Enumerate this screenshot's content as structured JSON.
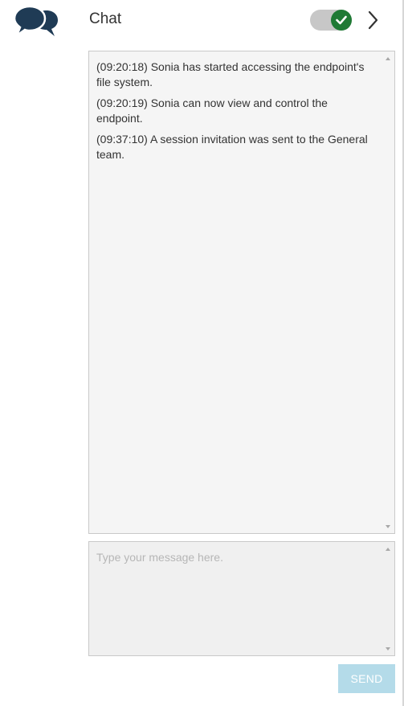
{
  "header": {
    "icon": "chat-bubbles-icon",
    "title": "Chat",
    "toggle": {
      "state": "on",
      "icon": "checkmark-icon",
      "knob_color": "#1f7a35"
    },
    "expand_icon": "chevron-right-icon"
  },
  "log": {
    "entries": [
      "(09:20:18) Sonia has started accessing the endpoint's file system.",
      "(09:20:19) Sonia can now view and control the endpoint.",
      "(09:37:10) A session invitation was sent to the General team."
    ]
  },
  "composer": {
    "placeholder": "Type your message here.",
    "value": "",
    "send_label": "SEND",
    "send_color": "#b4dbe9"
  },
  "colors": {
    "icon": "#1f3b55",
    "text": "#333333"
  }
}
